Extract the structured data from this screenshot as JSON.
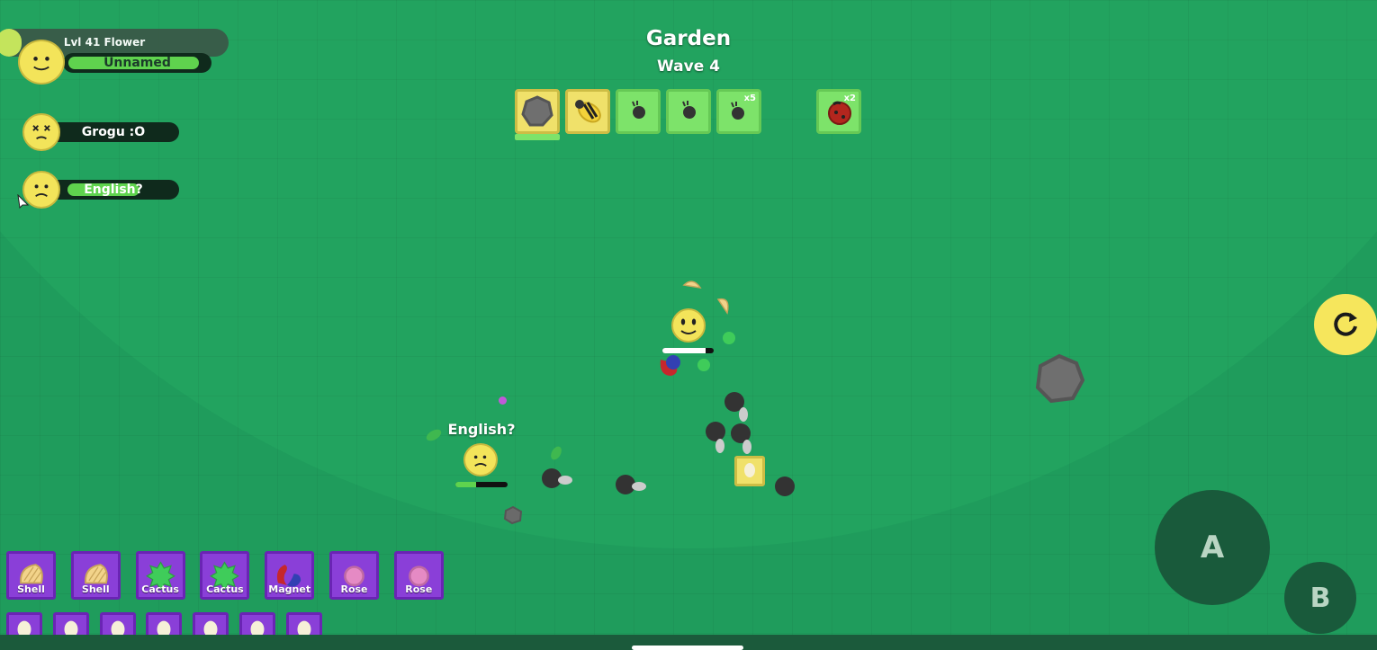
{
  "game": {
    "title": "Garden",
    "wave": "Wave 4"
  },
  "player": {
    "level_label": "Lvl 41 Flower",
    "level_progress": 0.1
  },
  "squad": [
    {
      "name": "Unnamed",
      "health": 1.0,
      "face": "smile"
    },
    {
      "name": "Grogu :O",
      "health": 0.0,
      "face": "dead"
    },
    {
      "name": "English?",
      "health": 0.6,
      "face": "sad"
    }
  ],
  "mob_preview": [
    {
      "mob": "rock-icon",
      "rarity": "unusual",
      "count": ""
    },
    {
      "mob": "bee-icon",
      "rarity": "unusual",
      "count": ""
    },
    {
      "mob": "small-rock-icon",
      "rarity": "common",
      "count": ""
    },
    {
      "mob": "small-rock-icon",
      "rarity": "common",
      "count": ""
    },
    {
      "mob": "small-rock-icon",
      "rarity": "common",
      "count": "x5"
    },
    {
      "mob": "ladybug-icon",
      "rarity": "common",
      "count": "x2"
    }
  ],
  "world": {
    "teammate_label": "English?",
    "teammate_health": 0.6,
    "self_health": 0.85
  },
  "petals": [
    {
      "label": "Shell",
      "icon": "shell-icon"
    },
    {
      "label": "Shell",
      "icon": "shell-icon"
    },
    {
      "label": "Cactus",
      "icon": "cactus-icon"
    },
    {
      "label": "Cactus",
      "icon": "cactus-icon"
    },
    {
      "label": "Magnet",
      "icon": "magnet-icon"
    },
    {
      "label": "Rose",
      "icon": "rose-icon"
    },
    {
      "label": "Rose",
      "icon": "rose-icon"
    }
  ],
  "secondary_petals": [
    {
      "label": "Egg",
      "icon": "egg-icon"
    },
    {
      "label": "Egg",
      "icon": "egg-icon"
    },
    {
      "label": "Egg",
      "icon": "egg-icon"
    },
    {
      "label": "Egg",
      "icon": "egg-icon"
    },
    {
      "label": "Egg",
      "icon": "egg-icon"
    },
    {
      "label": "Egg",
      "icon": "egg-icon"
    },
    {
      "label": "Egg",
      "icon": "egg-icon"
    }
  ],
  "controls": {
    "attack_label": "A",
    "defend_label": "B",
    "respawn_icon": "refresh-icon"
  },
  "colors": {
    "field": "#1f9c5c",
    "flower": "#f3e45a",
    "petal_slot": "#8a3fd8",
    "health": "#5fd34e"
  }
}
